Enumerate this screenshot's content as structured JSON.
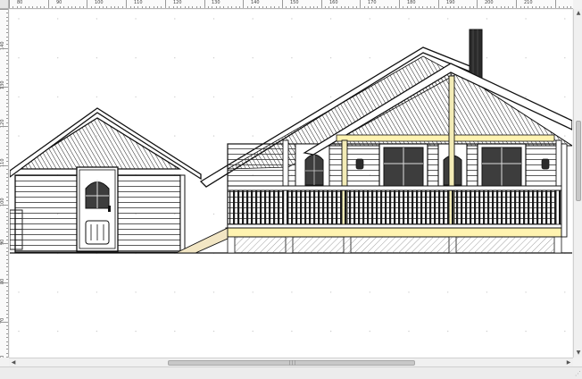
{
  "rulers": {
    "top_labels": [
      "80",
      "90",
      "100",
      "110",
      "120",
      "130",
      "140",
      "150",
      "160",
      "170",
      "180",
      "190",
      "200",
      "210"
    ],
    "left_labels": [
      "140",
      "130",
      "120",
      "110",
      "100",
      "90",
      "80",
      "70",
      "60",
      "50"
    ]
  },
  "scrollbars": {
    "up_arrow": "▲",
    "down_arrow": "▼",
    "left_arrow": "◀",
    "right_arrow": "▶",
    "grip": "|||"
  },
  "status": {
    "size_grip": "⋰"
  },
  "colors": {
    "canvas": "#ffffff",
    "line": "#1a1a1a",
    "deck_post": "#f3ecb6",
    "deck_beam": "#fff3b0",
    "ramp": "#f2e6c4",
    "chimney": "#2b2b2b"
  }
}
